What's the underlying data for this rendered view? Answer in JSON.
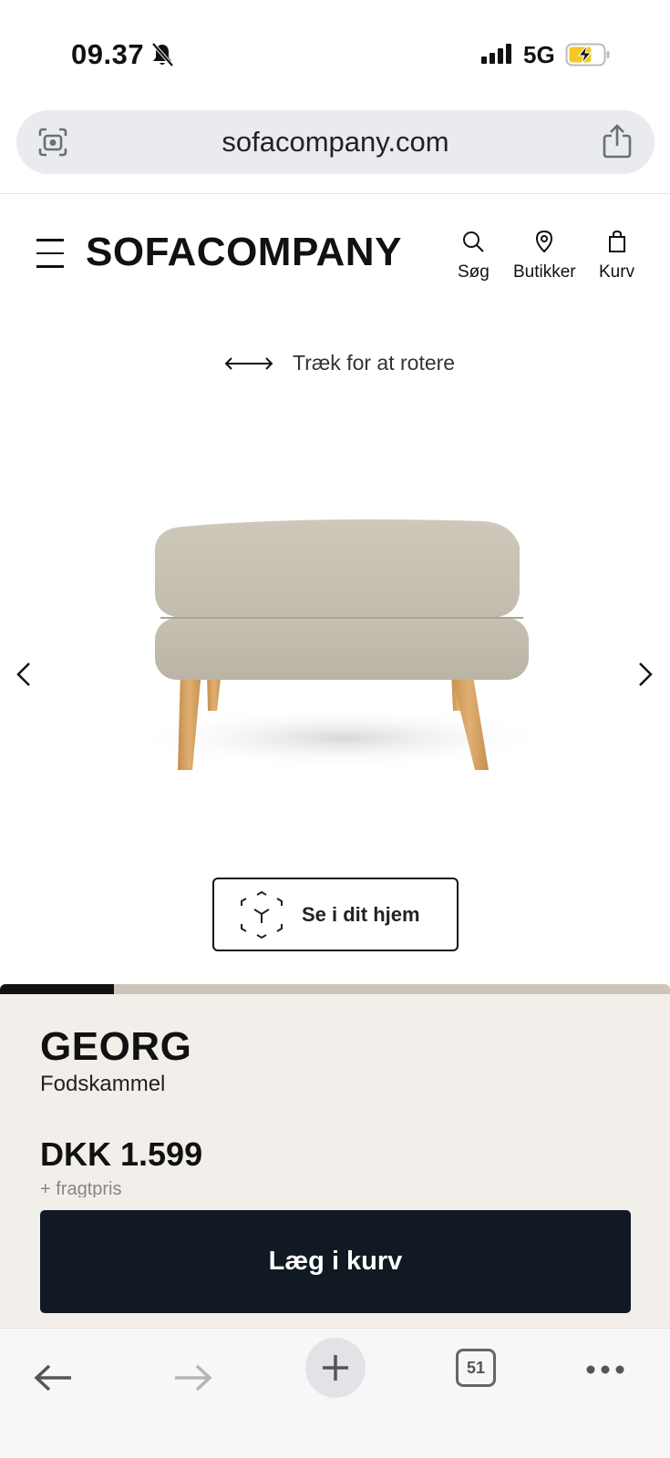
{
  "status_bar": {
    "time": "09.37",
    "network": "5G"
  },
  "browser": {
    "url": "sofacompany.com",
    "tab_count": "51"
  },
  "header": {
    "logo": "SOFACOMPANY",
    "search_label": "Søg",
    "stores_label": "Butikker",
    "cart_label": "Kurv"
  },
  "viewer": {
    "rotate_hint": "Træk for at rotere",
    "ar_button": "Se i dit hjem",
    "gallery_progress": 0.17
  },
  "product": {
    "name": "GEORG",
    "type": "Fodskammel",
    "price": "DKK 1.599",
    "freight_note": "+ fragtpris",
    "add_to_cart": "Læg i kurv"
  },
  "colors": {
    "dark_button": "#111a22",
    "details_bg": "#f2efeb",
    "progress_track": "#cfc4ba",
    "fabric": "#c9c3b6",
    "wood": "#d9a868"
  }
}
